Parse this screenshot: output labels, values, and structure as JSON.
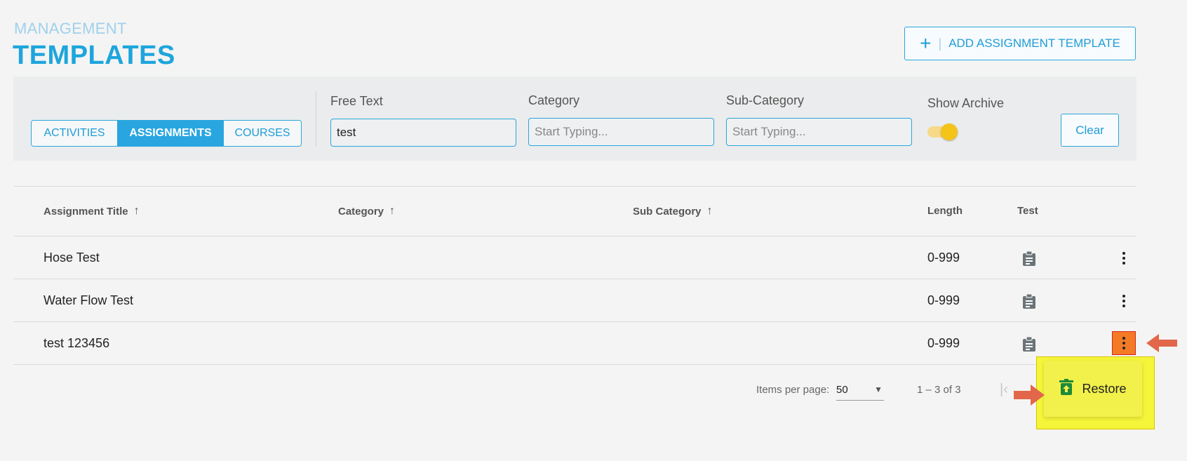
{
  "header": {
    "breadcrumb": "MANAGEMENT",
    "title": "TEMPLATES",
    "add_button": "ADD ASSIGNMENT TEMPLATE"
  },
  "filters": {
    "tabs": [
      {
        "label": "ACTIVITIES",
        "active": false
      },
      {
        "label": "ASSIGNMENTS",
        "active": true
      },
      {
        "label": "COURSES",
        "active": false
      }
    ],
    "free_text": {
      "label": "Free Text",
      "value": "test"
    },
    "category": {
      "label": "Category",
      "placeholder": "Start Typing..."
    },
    "sub_category": {
      "label": "Sub-Category",
      "placeholder": "Start Typing..."
    },
    "show_archive": {
      "label": "Show Archive",
      "on": true
    },
    "clear": "Clear"
  },
  "table": {
    "headers": {
      "title": "Assignment Title",
      "category": "Category",
      "sub_category": "Sub Category",
      "length": "Length",
      "test": "Test"
    },
    "rows": [
      {
        "title": "Hose Test",
        "category": "",
        "sub_category": "",
        "length": "0-999"
      },
      {
        "title": "Water Flow Test",
        "category": "",
        "sub_category": "",
        "length": "0-999"
      },
      {
        "title": "test 123456",
        "category": "",
        "sub_category": "",
        "length": "0-999"
      }
    ]
  },
  "pager": {
    "items_per_page_label": "Items per page:",
    "items_per_page": "50",
    "range": "1 – 3 of 3"
  },
  "context_menu": {
    "restore": "Restore"
  },
  "colors": {
    "accent": "#29a6e0",
    "highlight": "#f5f53a",
    "annotation_arrow": "#e2674a"
  }
}
